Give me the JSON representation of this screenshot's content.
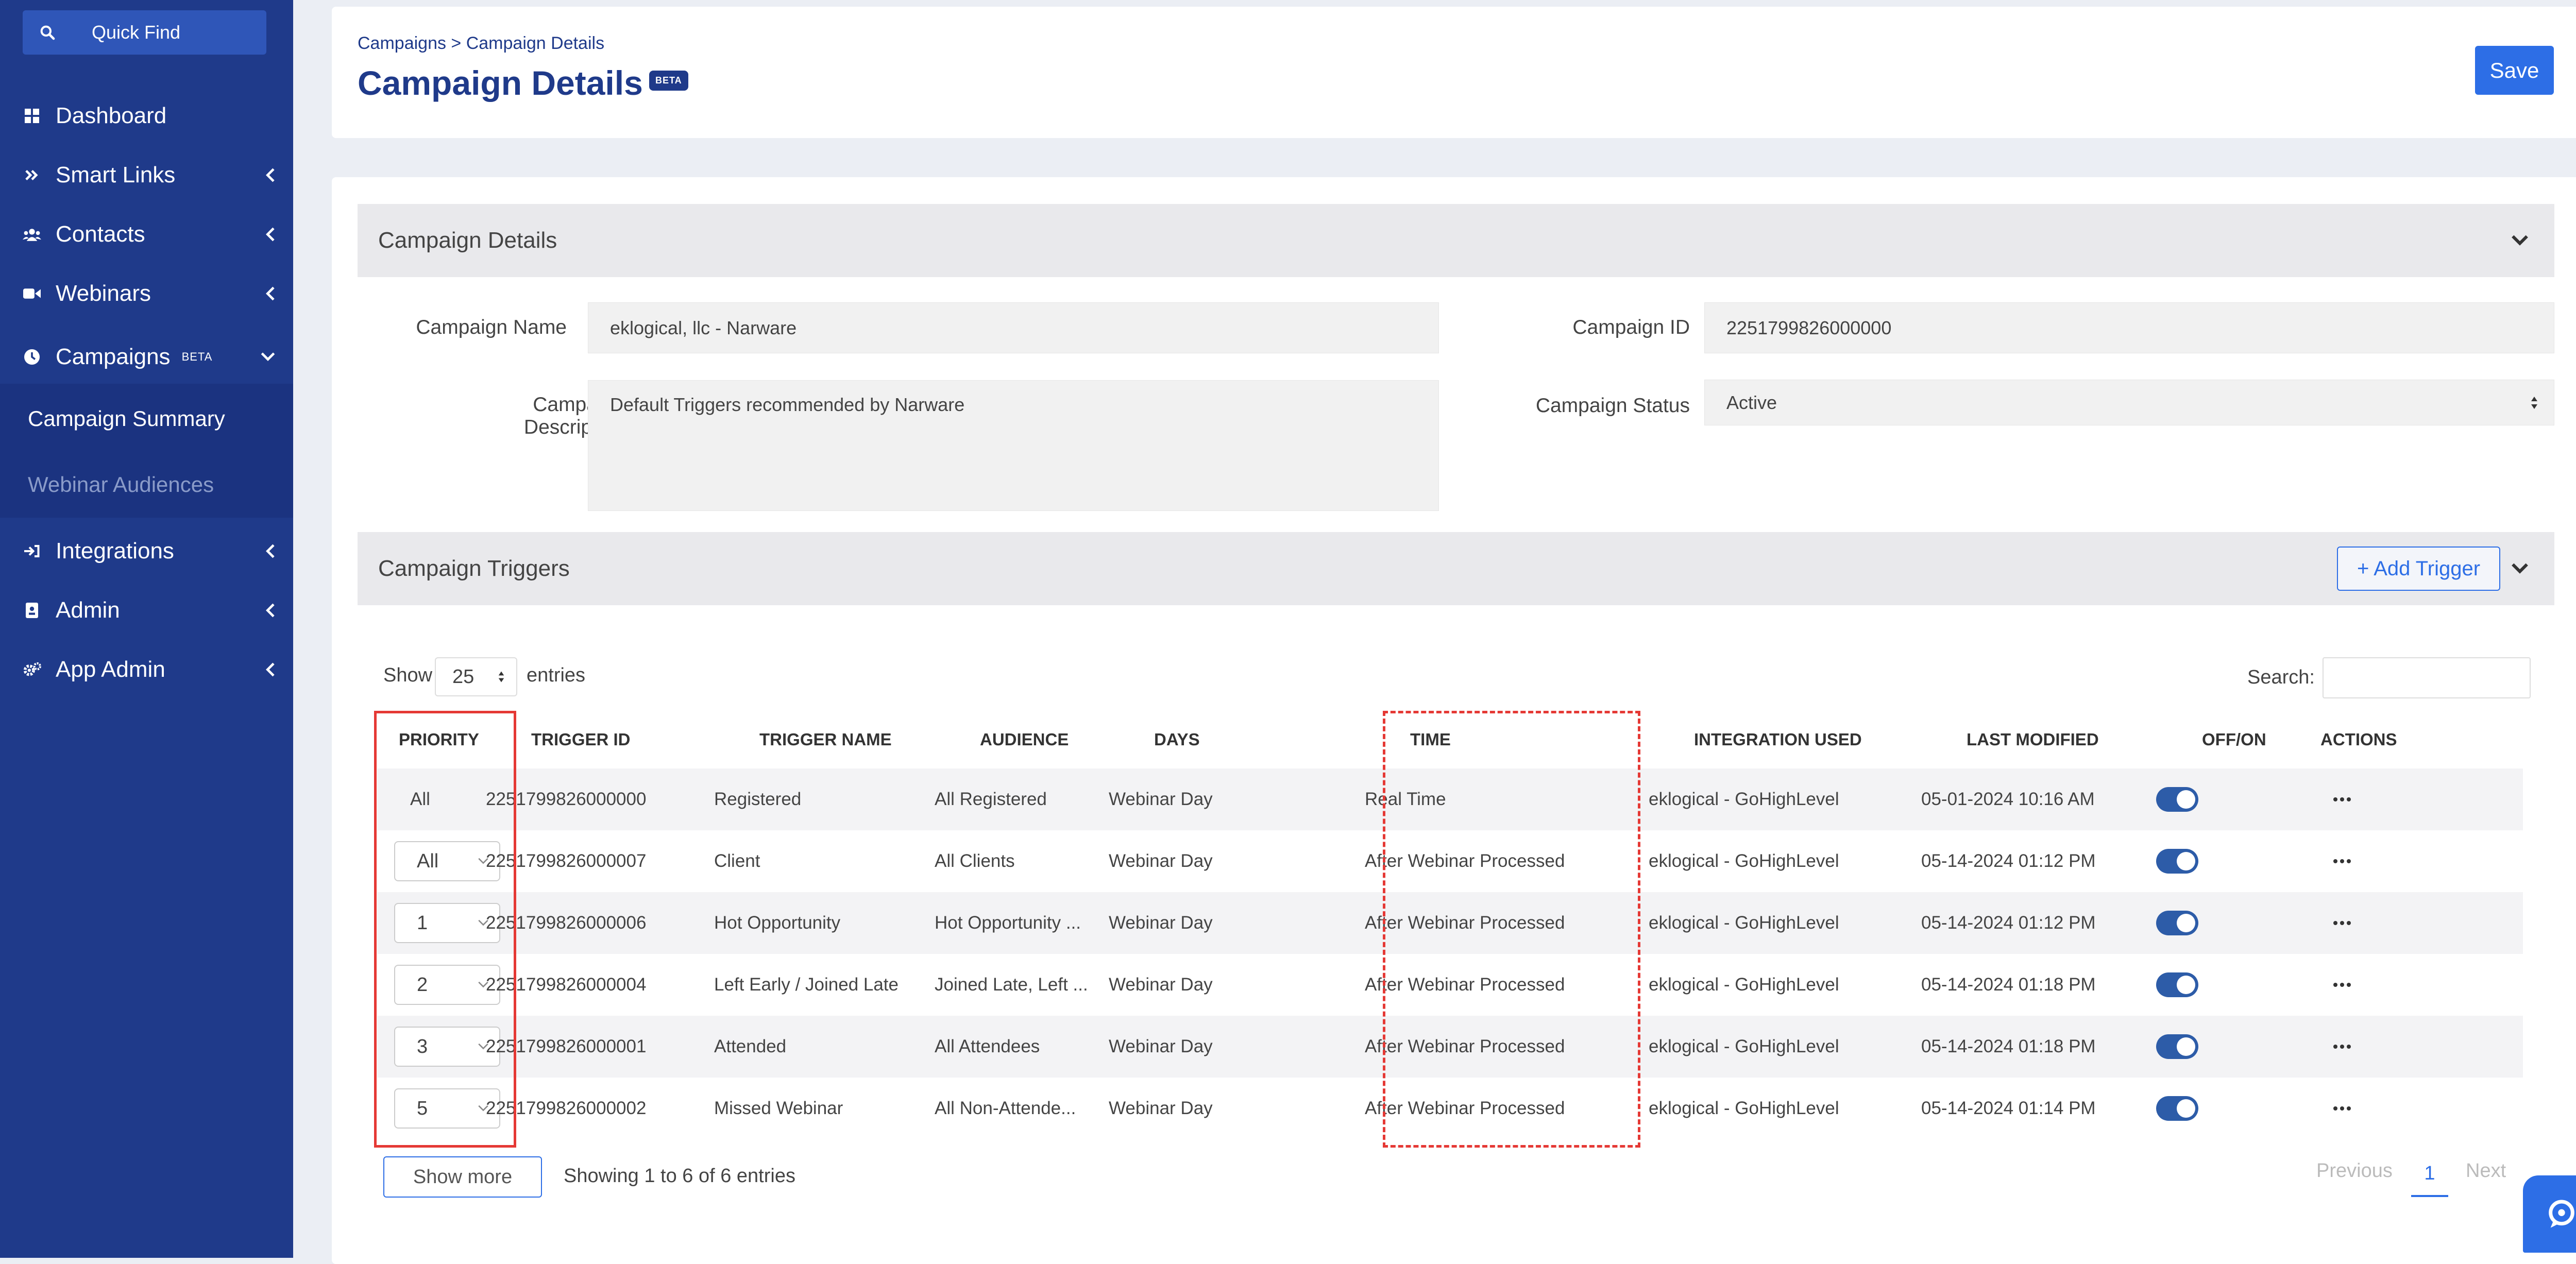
{
  "sidebar": {
    "quick_find": "Quick Find",
    "items": [
      {
        "label": "Dashboard"
      },
      {
        "label": "Smart Links"
      },
      {
        "label": "Contacts"
      },
      {
        "label": "Webinars"
      },
      {
        "label": "Campaigns",
        "badge": "BETA"
      },
      {
        "label": "Integrations"
      },
      {
        "label": "Admin"
      },
      {
        "label": "App Admin"
      }
    ],
    "sub_items": [
      {
        "label": "Campaign Summary"
      },
      {
        "label": "Webinar Audiences"
      }
    ]
  },
  "header": {
    "breadcrumb": "Campaigns > Campaign Details",
    "title": "Campaign Details",
    "badge": "BETA",
    "save_label": "Save"
  },
  "details": {
    "section_title": "Campaign Details",
    "name_label": "Campaign Name",
    "name_value": "eklogical, llc - Narware",
    "id_label": "Campaign ID",
    "id_value": "2251799826000000",
    "description_label_1": "Campaign",
    "description_label_2": "Description",
    "description_value": "Default Triggers recommended by Narware",
    "status_label": "Campaign Status",
    "status_value": "Active"
  },
  "triggers": {
    "section_title": "Campaign Triggers",
    "add_label": "+ Add Trigger",
    "show_label": "Show",
    "entries_value": "25",
    "entries_label": "entries",
    "search_label": "Search:",
    "columns": [
      "PRIORITY",
      "TRIGGER ID",
      "TRIGGER NAME",
      "AUDIENCE",
      "DAYS",
      "TIME",
      "INTEGRATION USED",
      "LAST MODIFIED",
      "OFF/ON",
      "ACTIONS"
    ],
    "rows": [
      {
        "priority": "All",
        "id": "2251799826000000",
        "name": "Registered",
        "audience": "All Registered",
        "days": "Webinar Day",
        "time": "Real Time",
        "integration": "eklogical - GoHighLevel",
        "modified": "05-01-2024 10:16 AM",
        "on": true
      },
      {
        "priority": "All",
        "id": "2251799826000007",
        "name": "Client",
        "audience": "All Clients",
        "days": "Webinar Day",
        "time": "After Webinar Processed",
        "integration": "eklogical - GoHighLevel",
        "modified": "05-14-2024 01:12 PM",
        "on": true
      },
      {
        "priority": "1",
        "id": "2251799826000006",
        "name": "Hot Opportunity",
        "audience": "Hot Opportunity ...",
        "days": "Webinar Day",
        "time": "After Webinar Processed",
        "integration": "eklogical - GoHighLevel",
        "modified": "05-14-2024 01:12 PM",
        "on": true
      },
      {
        "priority": "2",
        "id": "2251799826000004",
        "name": "Left Early / Joined Late",
        "audience": "Joined Late, Left ...",
        "days": "Webinar Day",
        "time": "After Webinar Processed",
        "integration": "eklogical - GoHighLevel",
        "modified": "05-14-2024 01:18 PM",
        "on": true
      },
      {
        "priority": "3",
        "id": "2251799826000001",
        "name": "Attended",
        "audience": "All Attendees",
        "days": "Webinar Day",
        "time": "After Webinar Processed",
        "integration": "eklogical - GoHighLevel",
        "modified": "05-14-2024 01:18 PM",
        "on": true
      },
      {
        "priority": "5",
        "id": "2251799826000002",
        "name": "Missed Webinar",
        "audience": "All Non-Attende...",
        "days": "Webinar Day",
        "time": "After Webinar Processed",
        "integration": "eklogical - GoHighLevel",
        "modified": "05-14-2024 01:14 PM",
        "on": true
      }
    ],
    "show_more_label": "Show more",
    "info": "Showing 1 to 6 of 6 entries",
    "previous_label": "Previous",
    "page": "1",
    "next_label": "Next"
  },
  "colors": {
    "sidebar": "#1f3a8a",
    "accent": "#2d6ee6",
    "highlight": "#e53935"
  }
}
